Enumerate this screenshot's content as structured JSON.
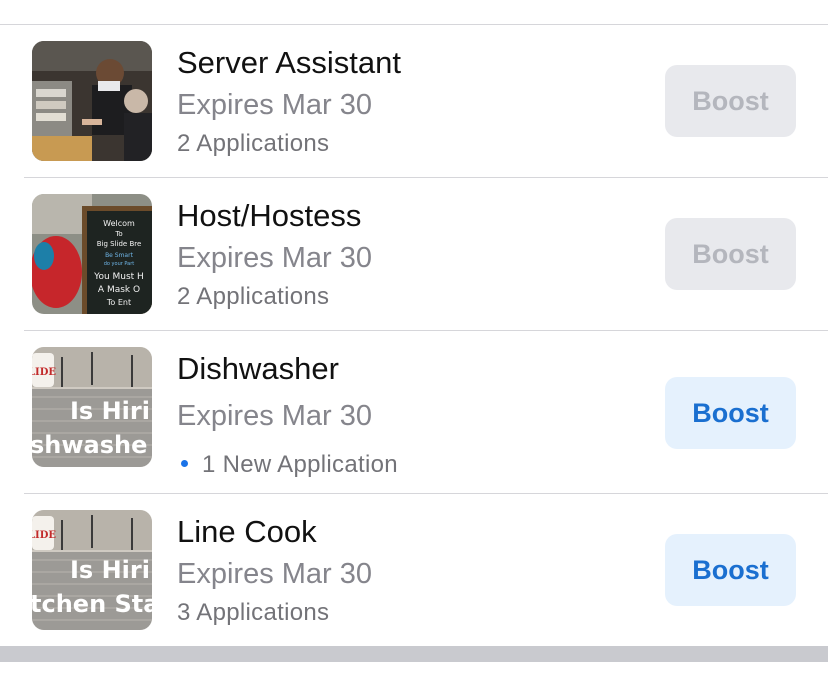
{
  "jobs": [
    {
      "title": "Server Assistant",
      "expires": "Expires Mar 30",
      "applications": "2 Applications",
      "has_new": false,
      "boost_label": "Boost",
      "boost_state": "disabled"
    },
    {
      "title": "Host/Hostess",
      "expires": "Expires Mar 30",
      "applications": "2 Applications",
      "has_new": false,
      "boost_label": "Boost",
      "boost_state": "disabled"
    },
    {
      "title": "Dishwasher",
      "expires": "Expires Mar 30",
      "applications": "1 New Application",
      "has_new": true,
      "boost_label": "Boost",
      "boost_state": "enabled"
    },
    {
      "title": "Line Cook",
      "expires": "Expires Mar 30",
      "applications": "3 Applications",
      "has_new": false,
      "boost_label": "Boost",
      "boost_state": "enabled"
    }
  ],
  "thumbnails": {
    "host_sign": [
      "Welcom",
      "To",
      "Big Slide Bre",
      "Be Smart",
      "do your Part",
      "You Must H",
      "A Mask O",
      "To Ent"
    ],
    "dishwasher_banner": [
      "LIDE",
      "Is Hiri",
      "shwashe"
    ],
    "linecook_banner": [
      "LIDE",
      "Is Hiri",
      "tchen Sta"
    ]
  },
  "colors": {
    "boost_enabled_bg": "#e5f1fd",
    "boost_enabled_text": "#1a6fd0",
    "boost_disabled_bg": "#e8e9ed",
    "boost_disabled_text": "#b4b6bd",
    "new_dot": "#1a73e8"
  }
}
